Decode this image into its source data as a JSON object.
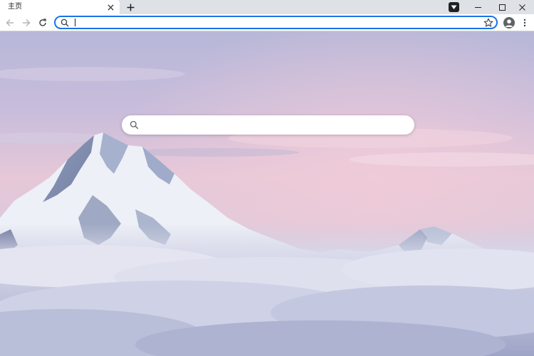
{
  "tab": {
    "title": "主页"
  },
  "omnibox": {
    "value": "",
    "placeholder": ""
  },
  "ntp": {
    "search_value": "",
    "search_placeholder": ""
  },
  "icons": {
    "tab_close": "close-icon",
    "new_tab": "plus-icon",
    "tab_search": "chevron-down-icon",
    "minimize": "minimize-icon",
    "maximize": "maximize-icon",
    "close_window": "close-icon",
    "back": "arrow-left-icon",
    "forward": "arrow-right-icon",
    "reload": "reload-icon",
    "omnibox_search": "search-icon",
    "bookmark": "star-icon",
    "profile": "avatar-icon",
    "menu": "kebab-menu-icon",
    "ntp_search": "search-icon"
  },
  "colors": {
    "focus_ring": "#1a73e8",
    "tabstrip": "#dee1e6",
    "sky_top": "#b9b9da",
    "sky_pink": "#e9c6d6",
    "cloud": "#e8e7f1"
  }
}
